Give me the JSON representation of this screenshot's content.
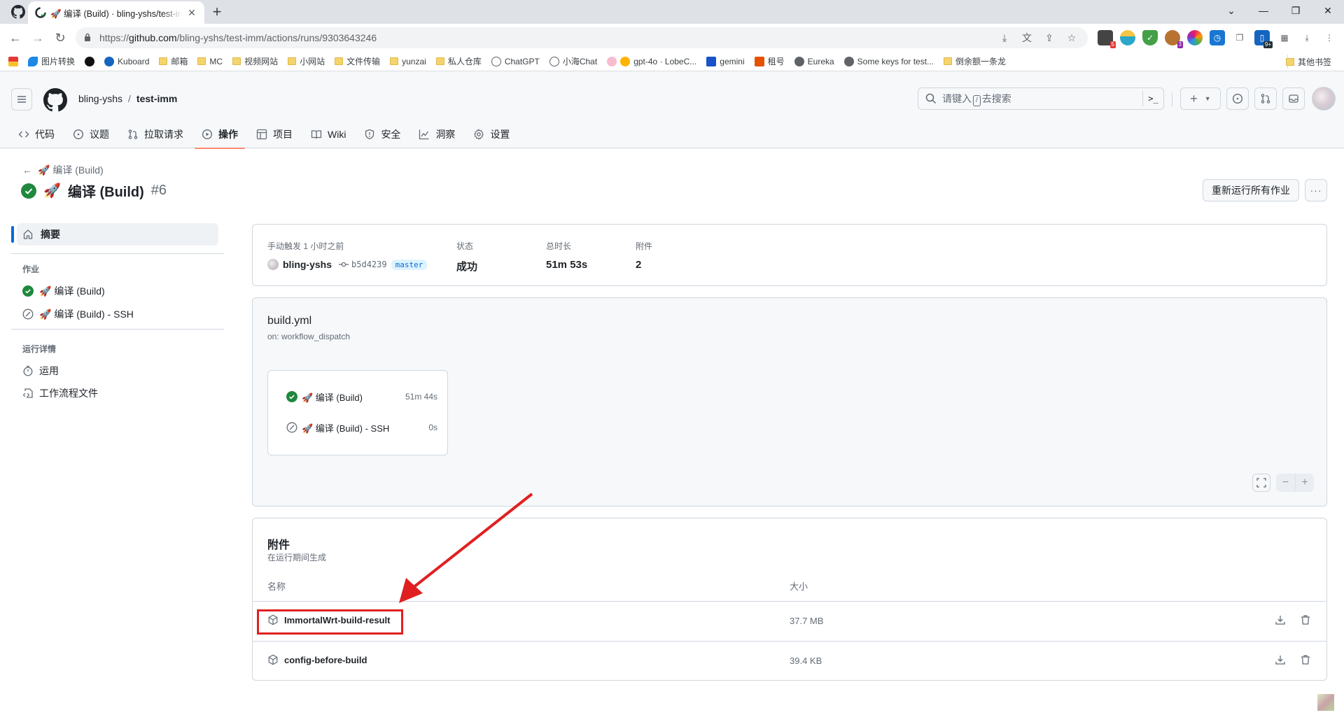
{
  "browser": {
    "tab_title": "🚀 编译 (Build) · bling-yshs/test-imm",
    "new_tab_label": "+",
    "url": "https://github.com/bling-yshs/test-imm/actions/runs/9303643246",
    "url_host": "github.com",
    "url_scheme": "https://",
    "url_path": "/bling-yshs/test-imm/actions/runs/9303643246",
    "extension_badges": [
      "5",
      "3",
      "9+"
    ],
    "bookmarks": [
      {
        "label": "",
        "icon": "app-icon"
      },
      {
        "label": "图片转换",
        "icon": "app-icon"
      },
      {
        "label": "",
        "icon": "app-icon"
      },
      {
        "label": "Kuboard",
        "icon": "k-icon"
      },
      {
        "label": "邮箱",
        "icon": "folder-icon"
      },
      {
        "label": "MC",
        "icon": "folder-icon"
      },
      {
        "label": "视频网站",
        "icon": "folder-icon"
      },
      {
        "label": "小网站",
        "icon": "folder-icon"
      },
      {
        "label": "文件传输",
        "icon": "folder-icon"
      },
      {
        "label": "yunzai",
        "icon": "folder-icon"
      },
      {
        "label": "私人仓库",
        "icon": "folder-icon"
      },
      {
        "label": "ChatGPT",
        "icon": "openai-icon"
      },
      {
        "label": "小海Chat",
        "icon": "openai-icon"
      },
      {
        "label": "gpt-4o · LobeC...",
        "icon": "lobe-icon"
      },
      {
        "label": "gemini",
        "icon": "gemini-icon"
      },
      {
        "label": "租号",
        "icon": "zu-icon"
      },
      {
        "label": "Eureka",
        "icon": "globe-icon"
      },
      {
        "label": "Some keys for test...",
        "icon": "globe-icon"
      },
      {
        "label": "倒余额一条龙",
        "icon": "folder-icon"
      }
    ],
    "other_bookmarks": "其他书签"
  },
  "header": {
    "owner": "bling-yshs",
    "separator": "/",
    "repo": "test-imm",
    "search_prefix": "请键入",
    "search_key": "/",
    "search_suffix": "去搜索",
    "command_palette": ">_",
    "new_label": "+"
  },
  "repo_nav": [
    {
      "label": "代码",
      "icon": "code-icon"
    },
    {
      "label": "议题",
      "icon": "issue-icon"
    },
    {
      "label": "拉取请求",
      "icon": "pull-request-icon"
    },
    {
      "label": "操作",
      "icon": "play-icon",
      "active": true
    },
    {
      "label": "项目",
      "icon": "table-icon"
    },
    {
      "label": "Wiki",
      "icon": "book-icon"
    },
    {
      "label": "安全",
      "icon": "shield-icon"
    },
    {
      "label": "洞察",
      "icon": "graph-icon"
    },
    {
      "label": "设置",
      "icon": "gear-icon"
    }
  ],
  "run": {
    "back_label": "🚀 编译 (Build)",
    "title_emoji": "🚀",
    "title": "编译 (Build)",
    "number": "#6",
    "rerun_label": "重新运行所有作业",
    "more_label": "···"
  },
  "sidebar": {
    "summary_label": "摘要",
    "jobs_heading": "作业",
    "jobs": [
      {
        "label": "🚀 编译 (Build)",
        "status": "success"
      },
      {
        "label": "🚀 编译 (Build) - SSH",
        "status": "skipped"
      }
    ],
    "details_heading": "运行详情",
    "details": [
      {
        "label": "运用",
        "icon": "stopwatch-icon"
      },
      {
        "label": "工作流程文件",
        "icon": "file-code-icon"
      }
    ]
  },
  "summary": {
    "trigger_label": "手动触发 1 小时之前",
    "actor": "bling-yshs",
    "commit_sha": "b5d4239",
    "branch": "master",
    "status_label": "状态",
    "status_value": "成功",
    "duration_label": "总时长",
    "duration_value": "51m 53s",
    "artifacts_label": "附件",
    "artifacts_value": "2"
  },
  "graph": {
    "file": "build.yml",
    "trigger": "on: workflow_dispatch",
    "jobs": [
      {
        "label": "🚀 编译 (Build)",
        "duration": "51m 44s",
        "status": "success"
      },
      {
        "label": "🚀 编译 (Build) - SSH",
        "duration": "0s",
        "status": "skipped"
      }
    ],
    "zoom_out": "−",
    "zoom_in": "+"
  },
  "artifacts": {
    "title": "附件",
    "subtitle": "在运行期间生成",
    "col_name": "名称",
    "col_size": "大小",
    "items": [
      {
        "name": "ImmortalWrt-build-result",
        "size": "37.7 MB",
        "highlighted": true
      },
      {
        "name": "config-before-build",
        "size": "39.4 KB",
        "highlighted": false
      }
    ]
  },
  "colors": {
    "success": "#1f883d",
    "active_tab_underline": "#fd8c73",
    "link_blue": "#0969da",
    "annotation_red": "#e02020"
  }
}
